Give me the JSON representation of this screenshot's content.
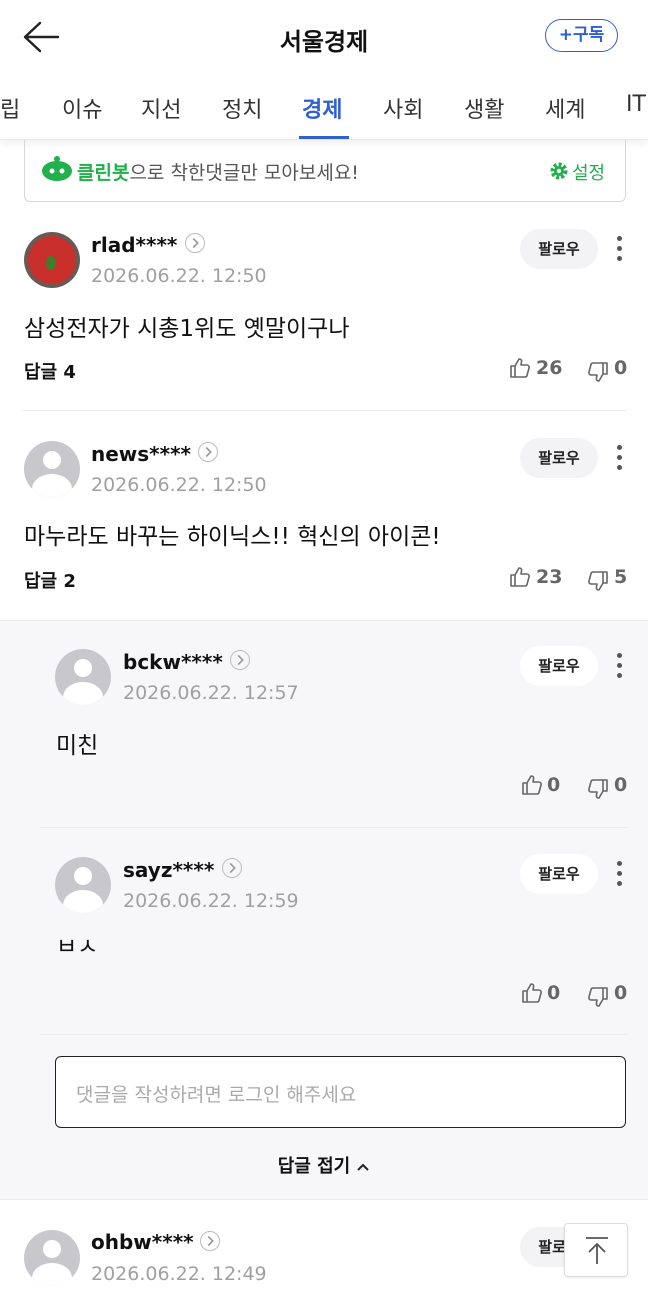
{
  "header": {
    "title": "서울경제",
    "subscribe_label": "+구독"
  },
  "tabs": [
    "립",
    "이슈",
    "지선",
    "정치",
    "경제",
    "사회",
    "생활",
    "세계",
    "IT"
  ],
  "active_tab": "경제",
  "cleanbot": {
    "brand": "클린봇",
    "text": "으로 착한댓글만 모아보세요!",
    "settings": "설정",
    "accent": "#21b04b"
  },
  "comments": [
    {
      "user": "rlad****",
      "date": "2026.06.22. 12:50",
      "text": "삼성전자가 시총1위도 옛말이구나",
      "reply": "답글 4",
      "likes": "26",
      "dislikes": "0",
      "follow": "팔로우"
    },
    {
      "user": "news****",
      "date": "2026.06.22. 12:50",
      "text": "마누라도 바꾸는 하이닉스!! 혁신의 아이콘!",
      "reply": "답글 2",
      "likes": "23",
      "dislikes": "5",
      "follow": "팔로우"
    },
    {
      "user": "ohbw****",
      "date": "2026.06.22. 12:49",
      "text": "",
      "follow": "팔로우"
    }
  ],
  "replies": [
    {
      "user": "bckw****",
      "date": "2026.06.22. 12:57",
      "text": "미친",
      "likes": "0",
      "dislikes": "0",
      "follow": "팔로우"
    },
    {
      "user": "sayz****",
      "date": "2026.06.22. 12:59",
      "text": "ㅂㅅ",
      "likes": "0",
      "dislikes": "0",
      "follow": "팔로우"
    }
  ],
  "reply_input": {
    "placeholder": "댓글을 작성하려면 로그인 해주세요"
  },
  "collapse_label": "답글 접기",
  "colors": {
    "accent": "#2f5fd0",
    "reply_bg": "#f7f7f9"
  }
}
